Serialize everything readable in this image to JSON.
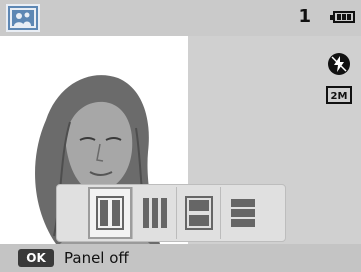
{
  "status": {
    "mode_icon": "people-scene-icon",
    "shot_count": "1",
    "battery_icon": "battery-full-icon"
  },
  "side_icons": [
    {
      "name": "flash-off-icon"
    },
    {
      "name": "image-size-2m-icon",
      "label": "2M"
    }
  ],
  "panel_options": [
    {
      "name": "two-vertical-panels",
      "selected": true
    },
    {
      "name": "three-vertical-panels",
      "selected": false
    },
    {
      "name": "two-horizontal-panels",
      "selected": false
    },
    {
      "name": "three-horizontal-panels",
      "selected": false
    }
  ],
  "footer": {
    "ok_label": "OK",
    "hint": "Panel off"
  }
}
